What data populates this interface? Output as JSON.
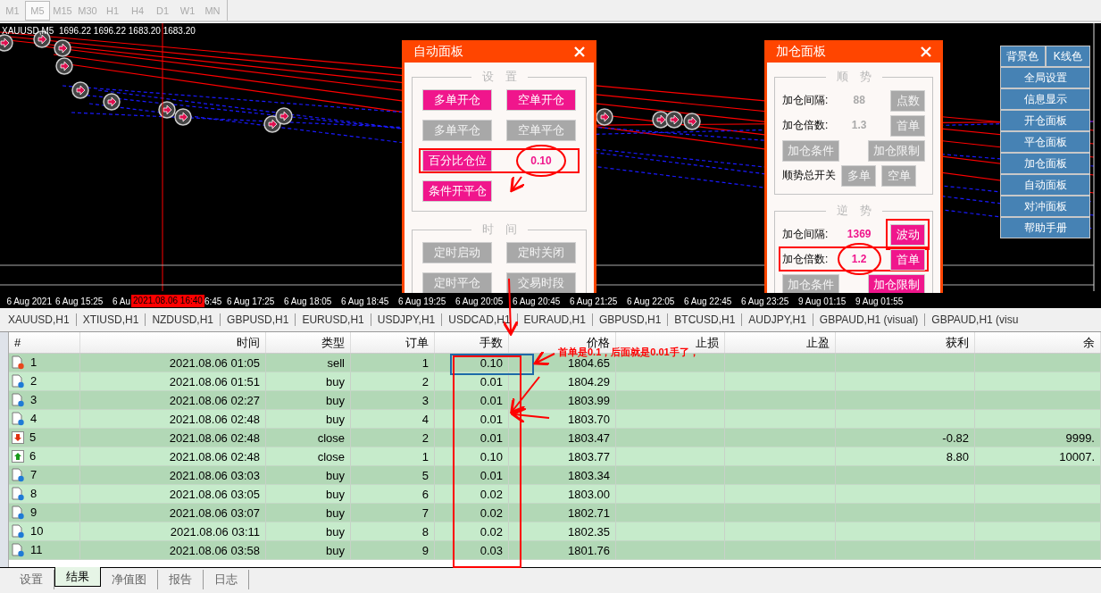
{
  "timeframes": [
    {
      "label": "M1",
      "selected": false
    },
    {
      "label": "M5",
      "selected": true
    },
    {
      "label": "M15",
      "selected": false
    },
    {
      "label": "M30",
      "selected": false
    },
    {
      "label": "H1",
      "selected": false
    },
    {
      "label": "H4",
      "selected": false
    },
    {
      "label": "D1",
      "selected": false
    },
    {
      "label": "W1",
      "selected": false
    },
    {
      "label": "MN",
      "selected": false
    }
  ],
  "chart": {
    "title": "XAUUSD,M5  1696.22 1696.22 1683.20 1683.20",
    "time_axis": [
      "6 Aug 2021",
      "6 Aug 15:25",
      "6 Au",
      "6:45",
      "6 Aug 17:25",
      "6 Aug 18:05",
      "6 Aug 18:45",
      "6 Aug 19:25",
      "6 Aug 20:05",
      "6 Aug 20:45",
      "6 Aug 21:25",
      "6 Aug 22:05",
      "6 Aug 22:45",
      "6 Aug 23:25",
      "9 Aug 01:15",
      "9 Aug 01:55"
    ],
    "crosshair_label": "2021.08.06 16:40"
  },
  "auto_panel": {
    "title": "自动面板",
    "sections": [
      {
        "title": "设　置",
        "rows": [
          {
            "highlighted": false,
            "items": [
              {
                "kind": "button",
                "label": "多单开仓",
                "active": true
              },
              {
                "kind": "button",
                "label": "空单开仓",
                "active": true
              }
            ]
          },
          {
            "highlighted": false,
            "items": [
              {
                "kind": "button",
                "label": "多单平仓",
                "active": false
              },
              {
                "kind": "button",
                "label": "空单平仓",
                "active": false
              }
            ]
          },
          {
            "highlighted": true,
            "items": [
              {
                "kind": "button",
                "label": "百分比仓位",
                "active": true
              },
              {
                "kind": "value",
                "label": "0.10",
                "active": true,
                "circled": true
              }
            ]
          },
          {
            "highlighted": false,
            "items": [
              {
                "kind": "button",
                "label": "条件开平仓",
                "active": true
              }
            ]
          }
        ]
      },
      {
        "title": "时　间",
        "rows": [
          {
            "highlighted": false,
            "items": [
              {
                "kind": "button",
                "label": "定时启动",
                "active": false
              },
              {
                "kind": "button",
                "label": "定时关闭",
                "active": false
              }
            ]
          },
          {
            "highlighted": false,
            "items": [
              {
                "kind": "button",
                "label": "定时平仓",
                "active": false
              },
              {
                "kind": "button",
                "label": "交易时段",
                "active": false
              }
            ]
          }
        ]
      }
    ]
  },
  "add_panel": {
    "title": "加仓面板",
    "sections": [
      {
        "title": "顺　势",
        "rows": [
          {
            "highlighted": false,
            "items": [
              {
                "kind": "label",
                "label": "加仓间隔:"
              },
              {
                "kind": "value",
                "label": "88",
                "active": false,
                "circled": false
              },
              {
                "kind": "button",
                "label": "点数",
                "active": false,
                "highlighted": false
              }
            ]
          },
          {
            "highlighted": false,
            "items": [
              {
                "kind": "label",
                "label": "加仓倍数:"
              },
              {
                "kind": "value",
                "label": "1.3",
                "active": false,
                "circled": false
              },
              {
                "kind": "button",
                "label": "首单",
                "active": false,
                "highlighted": false
              }
            ]
          },
          {
            "highlighted": false,
            "items": [
              {
                "kind": "button",
                "label": "加仓条件",
                "active": false,
                "highlighted": false
              },
              {
                "kind": "spacer"
              },
              {
                "kind": "button",
                "label": "加仓限制",
                "active": false,
                "highlighted": false
              }
            ]
          },
          {
            "highlighted": false,
            "items": [
              {
                "kind": "label",
                "label": "顺势总开关"
              },
              {
                "kind": "button",
                "label": "多单",
                "active": false,
                "highlighted": false
              },
              {
                "kind": "button",
                "label": "空单",
                "active": false,
                "highlighted": false
              }
            ]
          }
        ]
      },
      {
        "title": "逆　势",
        "rows": [
          {
            "highlighted": false,
            "items": [
              {
                "kind": "label",
                "label": "加仓间隔:"
              },
              {
                "kind": "value",
                "label": "1369",
                "active": true,
                "circled": false
              },
              {
                "kind": "button",
                "label": "波动",
                "active": true,
                "highlighted": true
              }
            ]
          },
          {
            "highlighted": true,
            "items": [
              {
                "kind": "label",
                "label": "加仓倍数:"
              },
              {
                "kind": "value",
                "label": "1.2",
                "active": true,
                "circled": true
              },
              {
                "kind": "button",
                "label": "首单",
                "active": true,
                "highlighted": false
              }
            ]
          },
          {
            "highlighted": false,
            "items": [
              {
                "kind": "button",
                "label": "加仓条件",
                "active": false,
                "highlighted": false
              },
              {
                "kind": "spacer"
              },
              {
                "kind": "button",
                "label": "加仓限制",
                "active": true,
                "highlighted": false
              }
            ]
          }
        ]
      }
    ]
  },
  "side_menu": [
    [
      "背景色",
      "K线色"
    ],
    [
      "全局设置"
    ],
    [
      "信息显示"
    ],
    [
      "开仓面板"
    ],
    [
      "平仓面板"
    ],
    [
      "加仓面板"
    ],
    [
      "自动面板"
    ],
    [
      "对冲面板"
    ],
    [
      "帮助手册"
    ]
  ],
  "symbol_tabs": [
    "XAUUSD,H1",
    "XTIUSD,H1",
    "NZDUSD,H1",
    "GBPUSD,H1",
    "EURUSD,H1",
    "USDJPY,H1",
    "USDCAD,H1",
    "EURAUD,H1",
    "GBPUSD,H1",
    "BTCUSD,H1",
    "AUDJPY,H1",
    "GBPAUD,H1 (visual)",
    "GBPAUD,H1 (visu"
  ],
  "table": {
    "columns": [
      "#",
      "时间",
      "类型",
      "订单",
      "手数",
      "价格",
      "止损",
      "止盈",
      "获利",
      "余"
    ],
    "rows": [
      {
        "kind": "sell",
        "n": "1",
        "time": "2021.08.06 01:05",
        "type": "sell",
        "order": "1",
        "lots": "0.10",
        "price": "1804.65"
      },
      {
        "kind": "buy",
        "n": "2",
        "time": "2021.08.06 01:51",
        "type": "buy",
        "order": "2",
        "lots": "0.01",
        "price": "1804.29"
      },
      {
        "kind": "buy",
        "n": "3",
        "time": "2021.08.06 02:27",
        "type": "buy",
        "order": "3",
        "lots": "0.01",
        "price": "1803.99"
      },
      {
        "kind": "buy",
        "n": "4",
        "time": "2021.08.06 02:48",
        "type": "buy",
        "order": "4",
        "lots": "0.01",
        "price": "1803.70"
      },
      {
        "kind": "close_down",
        "n": "5",
        "time": "2021.08.06 02:48",
        "type": "close",
        "order": "2",
        "lots": "0.01",
        "price": "1803.47",
        "profit": "-0.82",
        "balance": "9999."
      },
      {
        "kind": "close_up",
        "n": "6",
        "time": "2021.08.06 02:48",
        "type": "close",
        "order": "1",
        "lots": "0.10",
        "price": "1803.77",
        "profit": "8.80",
        "balance": "10007."
      },
      {
        "kind": "buy",
        "n": "7",
        "time": "2021.08.06 03:03",
        "type": "buy",
        "order": "5",
        "lots": "0.01",
        "price": "1803.34"
      },
      {
        "kind": "buy",
        "n": "8",
        "time": "2021.08.06 03:05",
        "type": "buy",
        "order": "6",
        "lots": "0.02",
        "price": "1803.00"
      },
      {
        "kind": "buy",
        "n": "9",
        "time": "2021.08.06 03:07",
        "type": "buy",
        "order": "7",
        "lots": "0.02",
        "price": "1802.71"
      },
      {
        "kind": "buy",
        "n": "10",
        "time": "2021.08.06 03:11",
        "type": "buy",
        "order": "8",
        "lots": "0.02",
        "price": "1802.35"
      },
      {
        "kind": "buy",
        "n": "11",
        "time": "2021.08.06 03:58",
        "type": "buy",
        "order": "9",
        "lots": "0.03",
        "price": "1801.76"
      }
    ]
  },
  "bottom_tabs": [
    {
      "label": "设置",
      "selected": false
    },
    {
      "label": "结果",
      "selected": true
    },
    {
      "label": "净值图",
      "selected": false
    },
    {
      "label": "报告",
      "selected": false
    },
    {
      "label": "日志",
      "selected": false
    }
  ],
  "annotation": {
    "text": "首单是0.1，后面就是0.01手了，"
  }
}
